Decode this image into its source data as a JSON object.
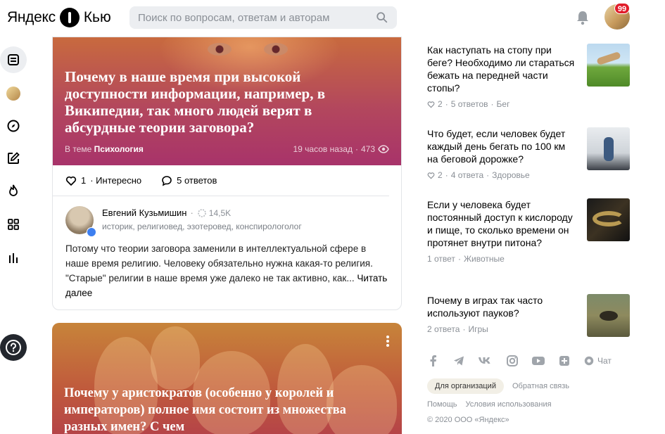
{
  "header": {
    "logo_brand": "Яндекс",
    "logo_product": "Кью",
    "search_placeholder": "Поиск по вопросам, ответам и авторам",
    "notifications_count": "99"
  },
  "rail": {
    "items": [
      "feed-icon",
      "profile-avatar",
      "compass-icon",
      "edit-icon",
      "fire-icon",
      "grid-icon",
      "stats-icon"
    ],
    "help_icon": "question-icon"
  },
  "feed": {
    "card1": {
      "title": "Почему в наше время при высокой доступности информации, например, в Википедии, так много людей верят в абсурдные теории заговора?",
      "topic_prefix": "В теме",
      "topic": "Психология",
      "time": "19 часов назад",
      "views_sep": "·",
      "views": "473",
      "likes": "1",
      "likes_label": "· Интересно",
      "answers": "5 ответов",
      "author_name": "Евгений Кузьмишин",
      "author_sep": "·",
      "author_score": "14,5K",
      "author_bio": "историк, религиовед, эзотеровед, конспирологолог",
      "answer_text": "Потому что теории заговора заменили в интеллектуальной сфере в наше время религию. Человеку обязательно нужна какая-то религия. \"Старые\" религии в наше время уже далеко не так активно, как... ",
      "read_more": "Читать далее"
    },
    "card2": {
      "title": "Почему у аристократов (особенно у королей и императоров) полное имя состоит из множества разных имен? С чем"
    }
  },
  "right_questions": [
    {
      "title": "Как наступать на стопу при беге? Необходимо ли стараться бежать на передней части стопы?",
      "likes": "2",
      "answers": "5 ответов",
      "topic": "Бег"
    },
    {
      "title": "Что будет, если человек будет каждый день бегать по 100 км на беговой дорожке?",
      "likes": "2",
      "answers": "4 ответа",
      "topic": "Здоровье"
    },
    {
      "title": "Если у человека будет постоянный доступ к кислороду и пище, то сколько времени он протянет внутри питона?",
      "answers": "1 ответ",
      "topic": "Животные"
    },
    {
      "title": "Почему в играх так часто используют пауков?",
      "answers": "2 ответа",
      "topic": "Игры"
    }
  ],
  "footer": {
    "socials": [
      "facebook-icon",
      "telegram-icon",
      "vk-icon",
      "instagram-icon",
      "youtube-icon",
      "plus-icon"
    ],
    "chat_label": "Чат",
    "org_button": "Для организаций",
    "feedback": "Обратная связь",
    "help": "Помощь",
    "terms": "Условия использования",
    "copyright": "© 2020 ООО «Яндекс»"
  },
  "colors": {
    "accent_blue": "#3d7ff0",
    "badge_red": "#e11d2a",
    "card1_gradient": "#b3475d",
    "card2_gradient": "#c05a3c"
  }
}
